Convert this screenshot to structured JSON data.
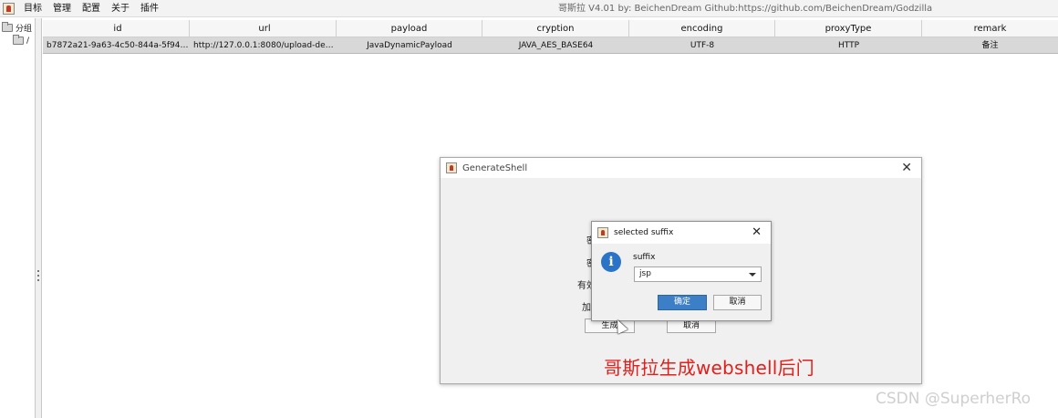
{
  "menubar": {
    "items": [
      "目标",
      "管理",
      "配置",
      "关于",
      "插件"
    ],
    "title": "哥斯拉   V4.01  by: BeichenDream Github:https://github.com/BeichenDream/Godzilla"
  },
  "tree": {
    "root_label": "分组",
    "child_label": "/"
  },
  "table": {
    "columns": [
      "id",
      "url",
      "payload",
      "cryption",
      "encoding",
      "proxyType",
      "remark"
    ],
    "rows": [
      {
        "id": "b7872a21-9a63-4c50-844a-5f94d...",
        "url": "http://127.0.0.1:8080/upload-dem...",
        "payload": "JavaDynamicPayload",
        "cryption": "JAVA_AES_BASE64",
        "encoding": "UTF-8",
        "proxyType": "HTTP",
        "remark": "备注"
      }
    ]
  },
  "generate_shell": {
    "title": "GenerateShell",
    "partial_labels": [
      "密",
      "密",
      "有效",
      "加"
    ],
    "generate_label": "生成",
    "cancel_label": "取消"
  },
  "suffix_dialog": {
    "title": "selected suffix",
    "field_label": "suffix",
    "selected_value": "jsp",
    "ok_label": "确定",
    "cancel_label": "取消"
  },
  "overlay_text": "哥斯拉生成webshell后门",
  "watermark": "CSDN @SuperherRo",
  "colors": {
    "overlay_red": "#e0201c",
    "primary_button": "#3d7fc7",
    "info_icon": "#2a73c6",
    "selected_row": "#d8d8d8"
  }
}
